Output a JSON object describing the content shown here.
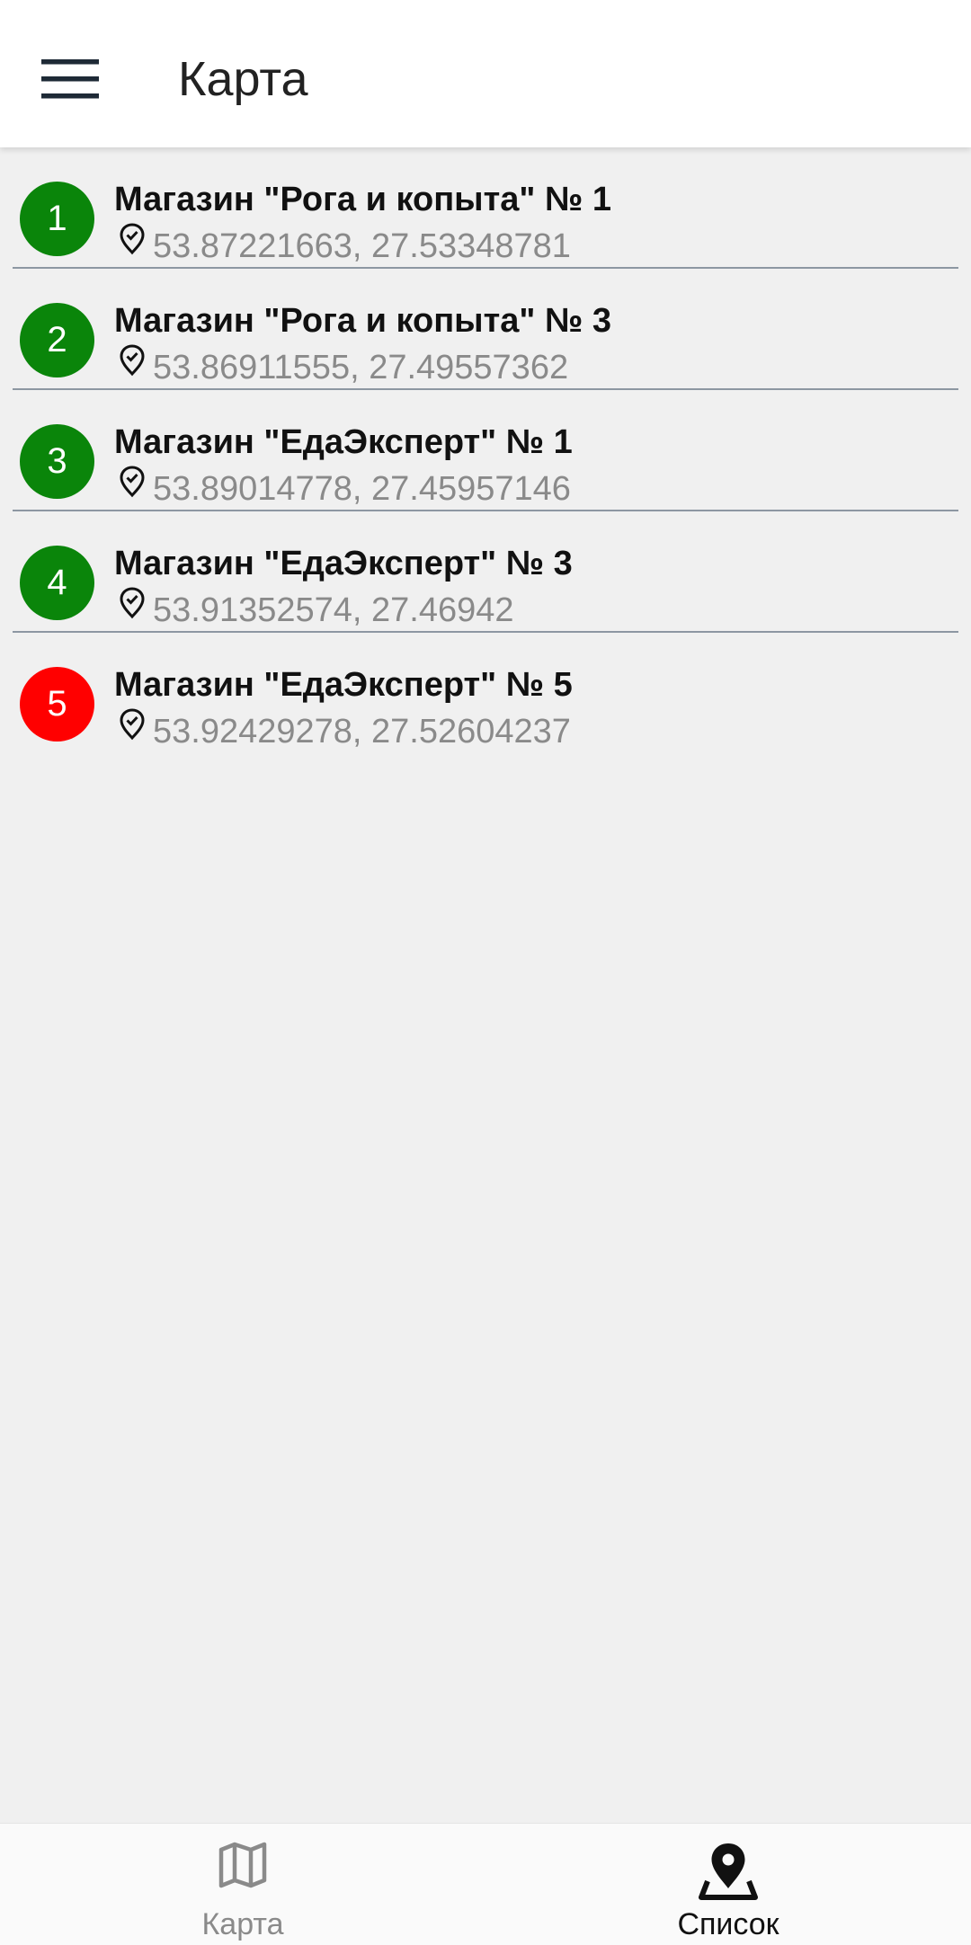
{
  "app_bar": {
    "title": "Карта",
    "menu_icon": "hamburger-menu-icon"
  },
  "stores": [
    {
      "number": "1",
      "name": "Магазин \"Рога и копыта\" № 1",
      "coords": "53.87221663, 27.53348781",
      "status_color": "#0a850a"
    },
    {
      "number": "2",
      "name": "Магазин \"Рога и копыта\" № 3",
      "coords": "53.86911555, 27.49557362",
      "status_color": "#0a850a"
    },
    {
      "number": "3",
      "name": "Магазин \"ЕдаЭксперт\" № 1",
      "coords": "53.89014778, 27.45957146",
      "status_color": "#0a850a"
    },
    {
      "number": "4",
      "name": "Магазин \"ЕдаЭксперт\" № 3",
      "coords": "53.91352574, 27.46942",
      "status_color": "#0a850a"
    },
    {
      "number": "5",
      "name": "Магазин \"ЕдаЭксперт\" № 5",
      "coords": "53.92429278, 27.52604237",
      "status_color": "#ff0000"
    }
  ],
  "bottom_nav": {
    "tabs": [
      {
        "label": "Карта",
        "icon": "map-icon",
        "active": false
      },
      {
        "label": "Список",
        "icon": "location-pin-icon",
        "active": true
      }
    ]
  },
  "colors": {
    "background": "#f0f0f0",
    "divider": "#8d97a2",
    "ok_status": "#0a850a",
    "alert_status": "#ff0000"
  }
}
